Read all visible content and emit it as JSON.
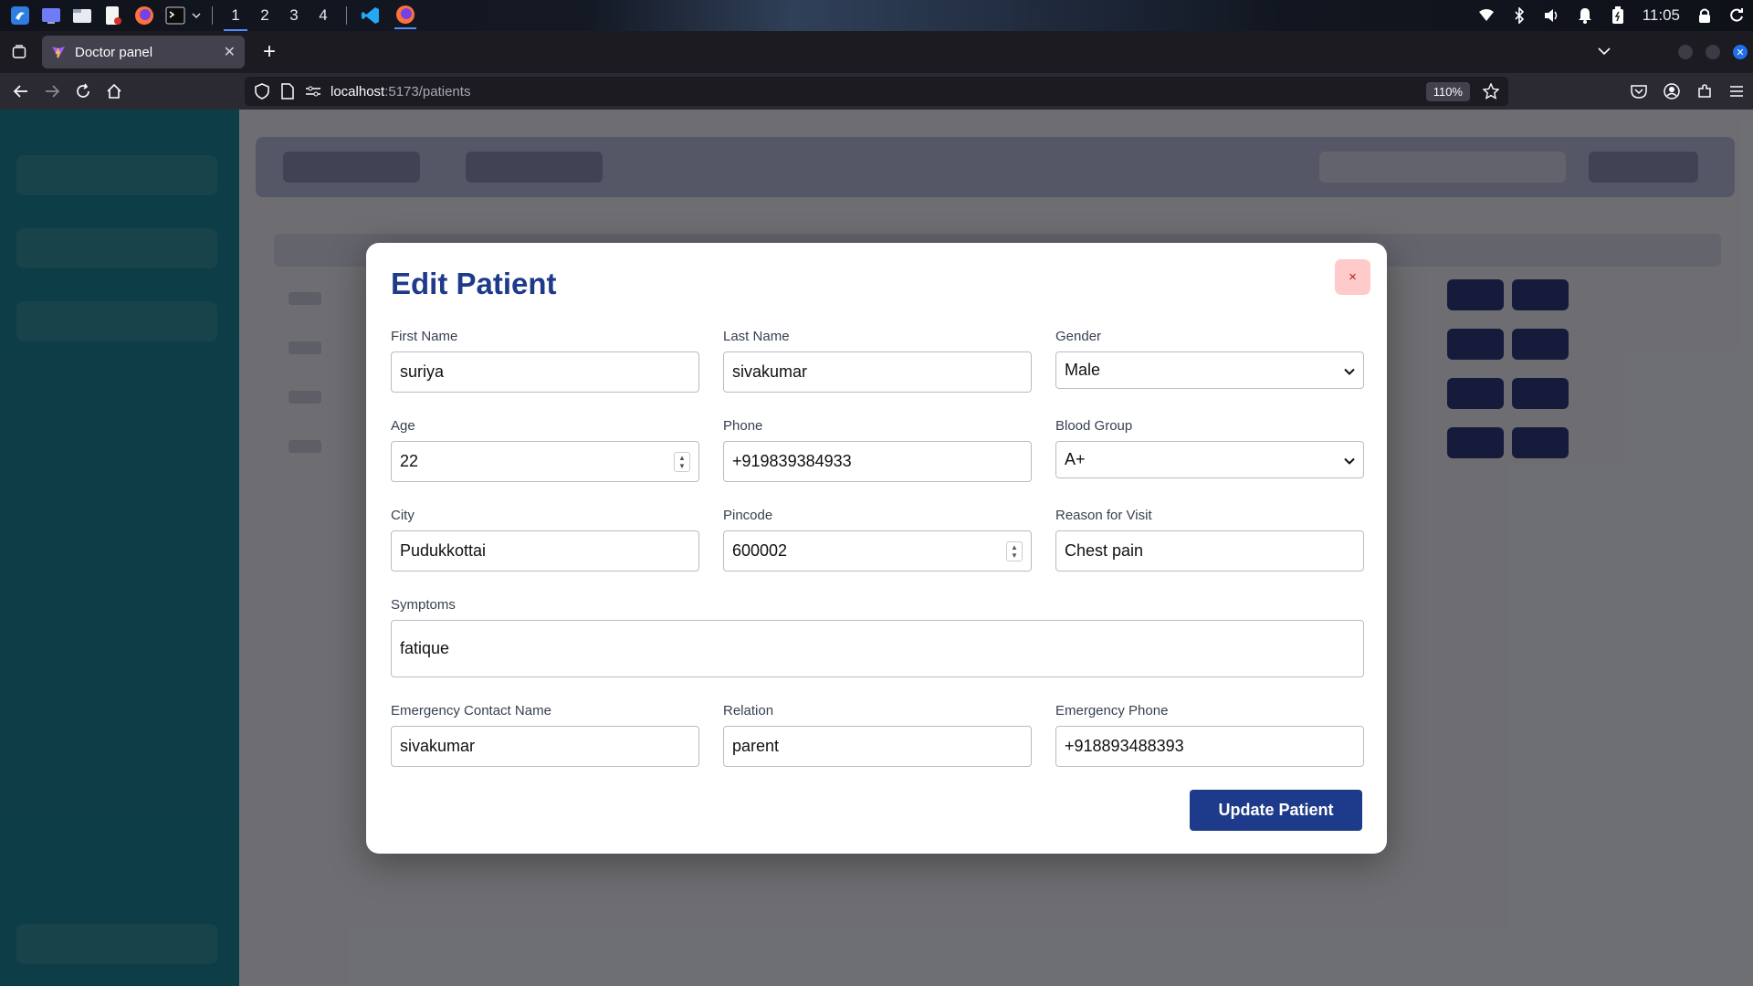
{
  "taskbar": {
    "workspaces": [
      "1",
      "2",
      "3",
      "4"
    ],
    "active_workspace": "1",
    "clock": "11:05"
  },
  "browser": {
    "tab_title": "Doctor panel",
    "url_host": "localhost",
    "url_path": ":5173/patients",
    "zoom": "110%"
  },
  "modal": {
    "title": "Edit Patient",
    "close_label": "×",
    "fields": {
      "first_name": {
        "label": "First Name",
        "value": "suriya"
      },
      "last_name": {
        "label": "Last Name",
        "value": "sivakumar"
      },
      "gender": {
        "label": "Gender",
        "value": "Male"
      },
      "age": {
        "label": "Age",
        "value": "22"
      },
      "phone": {
        "label": "Phone",
        "value": "+919839384933"
      },
      "blood_group": {
        "label": "Blood Group",
        "value": "A+"
      },
      "city": {
        "label": "City",
        "value": "Pudukkottai"
      },
      "pincode": {
        "label": "Pincode",
        "value": "600002"
      },
      "reason": {
        "label": "Reason for Visit",
        "value": "Chest pain"
      },
      "symptoms": {
        "label": "Symptoms",
        "value": "fatique"
      },
      "emergency_name": {
        "label": "Emergency Contact Name",
        "value": "sivakumar"
      },
      "relation": {
        "label": "Relation",
        "value": "parent"
      },
      "emergency_phone": {
        "label": "Emergency Phone",
        "value": "+918893488393"
      }
    },
    "submit_label": "Update Patient"
  },
  "colors": {
    "primary": "#1e3a8a",
    "sidebar": "#1d7f92",
    "close_bg": "#fecaca"
  }
}
